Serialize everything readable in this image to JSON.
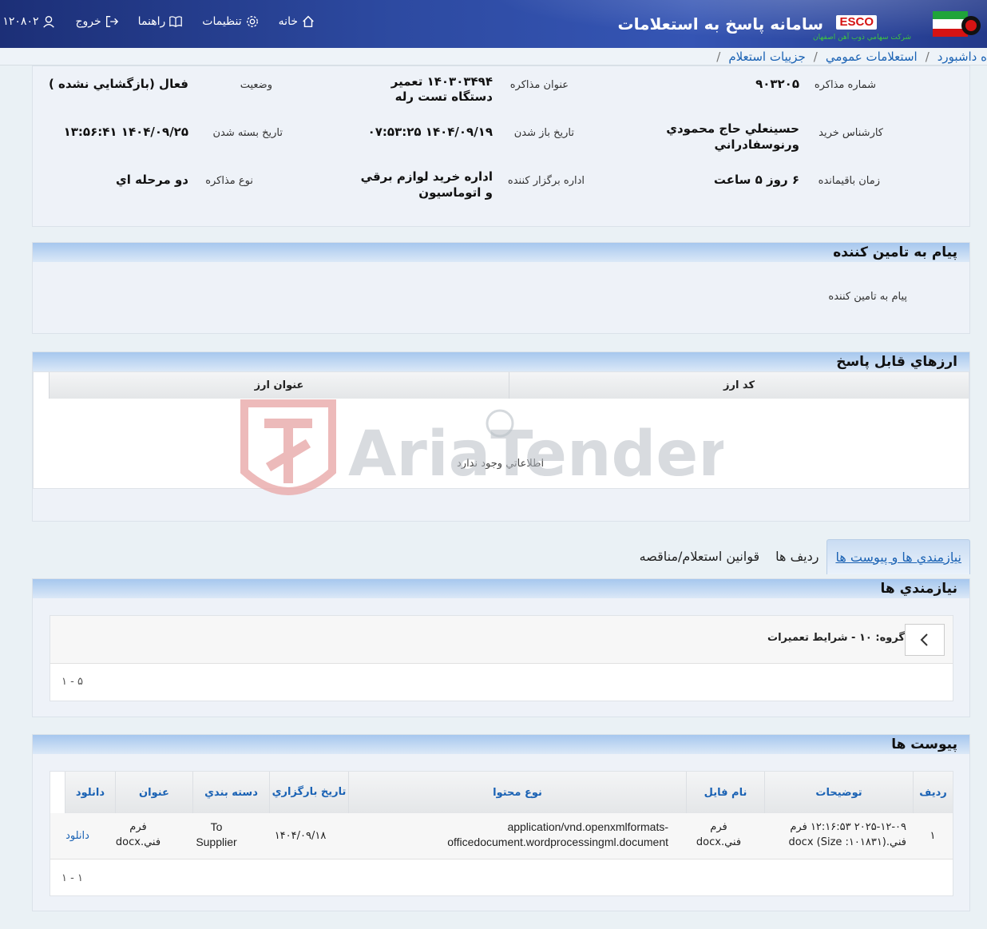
{
  "header": {
    "app_title": "سامانه پاسخ به استعلامات",
    "esco_label": "ESCO",
    "esco_subtitle": "شركت سهامي ذوب آهن اصفهان",
    "nav": [
      {
        "label": "خانه",
        "icon": "home-icon"
      },
      {
        "label": "تنظيمات",
        "icon": "gear-icon"
      },
      {
        "label": "راهنما",
        "icon": "book-icon"
      },
      {
        "label": "خروج",
        "icon": "logout-icon"
      },
      {
        "label": "۱۲۰۸۰۲",
        "icon": "user-icon"
      }
    ]
  },
  "breadcrumb": {
    "items": [
      "ه داشبورد",
      "استعلامات عمومي",
      "جزييات استعلام"
    ]
  },
  "details": {
    "row1": {
      "number_label": "شماره مذاكره",
      "number_value": "۹۰۳۲۰۵",
      "title_label": "عنوان مذاكره",
      "title_value": "۱۴۰۳۰۳۴۹۴ تعمير دستگاه تست رله",
      "status_label": "وضعيت",
      "status_value": "فعال (بازگشايي نشده )"
    },
    "row2": {
      "expert_label": "كارشناس خريد",
      "expert_value": "حسينعلي حاج محمودي ورنوسفادراني",
      "open_label": "تاريخ باز شدن",
      "open_value": "۱۴۰۴/۰۹/۱۹ ۰۷:۵۳:۲۵",
      "close_label": "تاريخ بسته شدن",
      "close_value": "۱۴۰۴/۰۹/۲۵ ۱۳:۵۶:۴۱"
    },
    "row3": {
      "remaining_label": "زمان باقيمانده",
      "remaining_value": "۶ روز ۵ ساعت",
      "org_label": "اداره برگزار كننده",
      "org_value": "اداره خريد لوازم برقي و اتوماسيون",
      "type_label": "نوع مذاكره",
      "type_value": "دو مرحله اي"
    }
  },
  "supplier_message": {
    "heading": "پيام به تامين كننده",
    "label": "پيام به تامين كننده"
  },
  "currencies": {
    "heading": "ارزهاي قابل پاسخ",
    "columns": [
      "كد ارز",
      "عنوان ارز"
    ],
    "empty_text": "اطلاعاتي وجود ندارد"
  },
  "tabs": [
    "نيازمندي ها و پيوست ها",
    "رديف ها",
    "قوانين استعلام/مناقصه"
  ],
  "requirements": {
    "heading": "نيازمندي ها",
    "group_label": "گروه: ۱۰ - شرايط تعميرات",
    "pager": "۱ - ۵"
  },
  "attachments": {
    "heading": "پيوست ها",
    "columns": [
      "رديف",
      "توضيحات",
      "نام فايل",
      "نوع محتوا",
      "تاريخ بارگزاري",
      "دسته بندي",
      "عنوان",
      "دانلود"
    ],
    "rows": [
      {
        "index": "۱",
        "description": "۲۰۲۵-۱۲-۰۹ ۱۲:۱۶:۵۳ فرم فني.docx (Size :۱۰۱۸۳۱)",
        "filename": "فرم فني.docx",
        "content_type": "application/vnd.openxmlformats-officedocument.wordprocessingml.document",
        "upload_date": "۱۴۰۴/۰۹/۱۸",
        "category": "To Supplier",
        "title": "فرم فني.docx",
        "download": "دانلود"
      }
    ],
    "pager": "۱ - ۱"
  },
  "watermark": "AriaTender.neT",
  "colors": {
    "header_dark": "#1c2f77",
    "link": "#1a62b4",
    "panel_head": "#a6c7ee"
  }
}
